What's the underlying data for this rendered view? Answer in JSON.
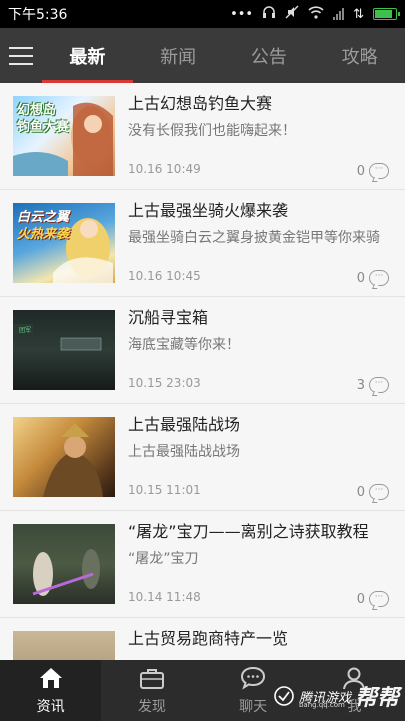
{
  "status": {
    "time": "下午5:36",
    "battery_level": 0.9,
    "colors": {
      "battery": "#3fc04a"
    }
  },
  "tabs": [
    {
      "label": "最新",
      "active": true
    },
    {
      "label": "新闻",
      "active": false
    },
    {
      "label": "公告",
      "active": false
    },
    {
      "label": "攻略",
      "active": false
    }
  ],
  "articles": [
    {
      "title": "上古幻想岛钓鱼大赛",
      "desc": "没有长假我们也能嗨起来！",
      "time": "10.16 10:49",
      "comments": "0",
      "thumb_text": "幻想岛\n钓鱼大赛"
    },
    {
      "title": "上古最强坐骑火爆来袭",
      "desc": "最强坐骑白云之翼身披黄金铠甲等你来骑",
      "time": "10.16 10:45",
      "comments": "0",
      "thumb_text": "白云之翼\n火热来袭"
    },
    {
      "title": "沉船寻宝箱",
      "desc": "海底宝藏等你来！",
      "time": "10.15 23:03",
      "comments": "3",
      "thumb_text": ""
    },
    {
      "title": "上古最强陆战场",
      "desc": "上古最强陆战战场",
      "time": "10.15 11:01",
      "comments": "0",
      "thumb_text": ""
    },
    {
      "title": "“屠龙”宝刀——离别之诗获取教程",
      "desc": "“屠龙”宝刀",
      "time": "10.14 11:48",
      "comments": "0",
      "thumb_text": ""
    },
    {
      "title": "上古贸易跑商特产一览",
      "desc": "",
      "time": "",
      "comments": "",
      "thumb_text": ""
    }
  ],
  "bottom_nav": [
    {
      "label": "资讯",
      "icon": "home-icon",
      "active": true
    },
    {
      "label": "发现",
      "icon": "briefcase-icon",
      "active": false
    },
    {
      "label": "聊天",
      "icon": "chat-icon",
      "active": false
    },
    {
      "label": "我",
      "icon": "person-icon",
      "active": false
    }
  ],
  "watermark": {
    "brand": "腾讯游戏",
    "big": "帮帮",
    "url": "bang.qq.com"
  }
}
